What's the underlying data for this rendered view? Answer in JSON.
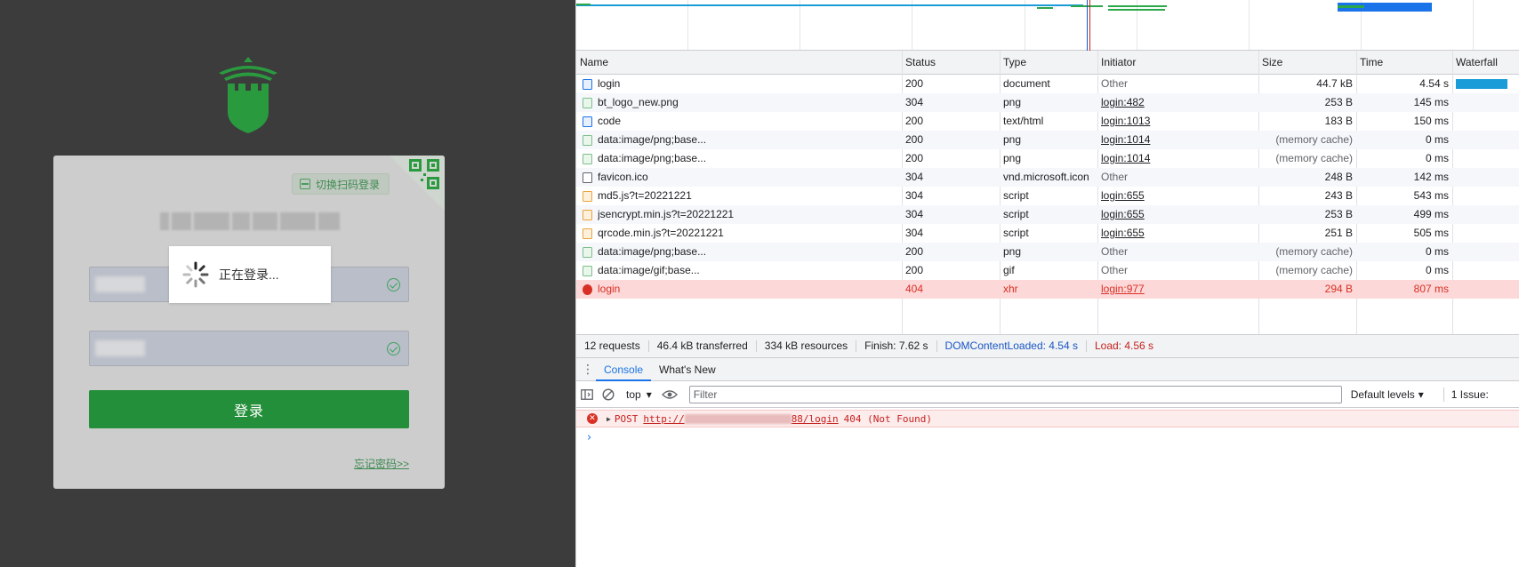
{
  "login_page": {
    "qr_toggle_label": "切换扫码登录",
    "loading_text": "正在登录...",
    "login_button": "登录",
    "forgot_link": "忘记密码>>",
    "accent_color": "#248f3a"
  },
  "network": {
    "columns": [
      "Name",
      "Status",
      "Type",
      "Initiator",
      "Size",
      "Time",
      "Waterfall"
    ],
    "rows": [
      {
        "name": "login",
        "status": "200",
        "type": "document",
        "initiator": "Other",
        "size": "44.7 kB",
        "time": "4.54 s",
        "icon": "document-icon"
      },
      {
        "name": "bt_logo_new.png",
        "status": "304",
        "type": "png",
        "initiator": "login:482",
        "size": "253 B",
        "time": "145 ms",
        "icon": "image-icon"
      },
      {
        "name": "code",
        "status": "200",
        "type": "text/html",
        "initiator": "login:1013",
        "size": "183 B",
        "time": "150 ms",
        "icon": "document-icon"
      },
      {
        "name": "data:image/png;base...",
        "status": "200",
        "type": "png",
        "initiator": "login:1014",
        "size": "(memory cache)",
        "time": "0 ms",
        "icon": "image-icon"
      },
      {
        "name": "data:image/png;base...",
        "status": "200",
        "type": "png",
        "initiator": "login:1014",
        "size": "(memory cache)",
        "time": "0 ms",
        "icon": "image-icon"
      },
      {
        "name": "favicon.ico",
        "status": "304",
        "type": "vnd.microsoft.icon",
        "initiator": "Other",
        "size": "248 B",
        "time": "142 ms",
        "icon": "blank-icon"
      },
      {
        "name": "md5.js?t=20221221",
        "status": "304",
        "type": "script",
        "initiator": "login:655",
        "size": "243 B",
        "time": "543 ms",
        "icon": "script-icon"
      },
      {
        "name": "jsencrypt.min.js?t=20221221",
        "status": "304",
        "type": "script",
        "initiator": "login:655",
        "size": "253 B",
        "time": "499 ms",
        "icon": "script-icon"
      },
      {
        "name": "qrcode.min.js?t=20221221",
        "status": "304",
        "type": "script",
        "initiator": "login:655",
        "size": "251 B",
        "time": "505 ms",
        "icon": "script-icon"
      },
      {
        "name": "data:image/png;base...",
        "status": "200",
        "type": "png",
        "initiator": "Other",
        "size": "(memory cache)",
        "time": "0 ms",
        "icon": "image-icon"
      },
      {
        "name": "data:image/gif;base...",
        "status": "200",
        "type": "gif",
        "initiator": "Other",
        "size": "(memory cache)",
        "time": "0 ms",
        "icon": "image-icon"
      },
      {
        "name": "login",
        "status": "404",
        "type": "xhr",
        "initiator": "login:977",
        "size": "294 B",
        "time": "807 ms",
        "icon": "error-icon",
        "error": true
      }
    ],
    "summary": {
      "requests": "12 requests",
      "transferred": "46.4 kB transferred",
      "resources": "334 kB resources",
      "finish": "Finish: 7.62 s",
      "dom_content_loaded": "DOMContentLoaded: 4.54 s",
      "load": "Load: 4.56 s"
    }
  },
  "drawer": {
    "tabs": [
      "Console",
      "What's New"
    ],
    "active_tab": "Console"
  },
  "console": {
    "context": "top",
    "filter_placeholder": "Filter",
    "levels": "Default levels",
    "issues": "1 Issue:",
    "error": {
      "method": "POST",
      "url_prefix": "http://",
      "url_suffix": "88/login",
      "status": "404 (Not Found)"
    },
    "prompt": "›"
  }
}
